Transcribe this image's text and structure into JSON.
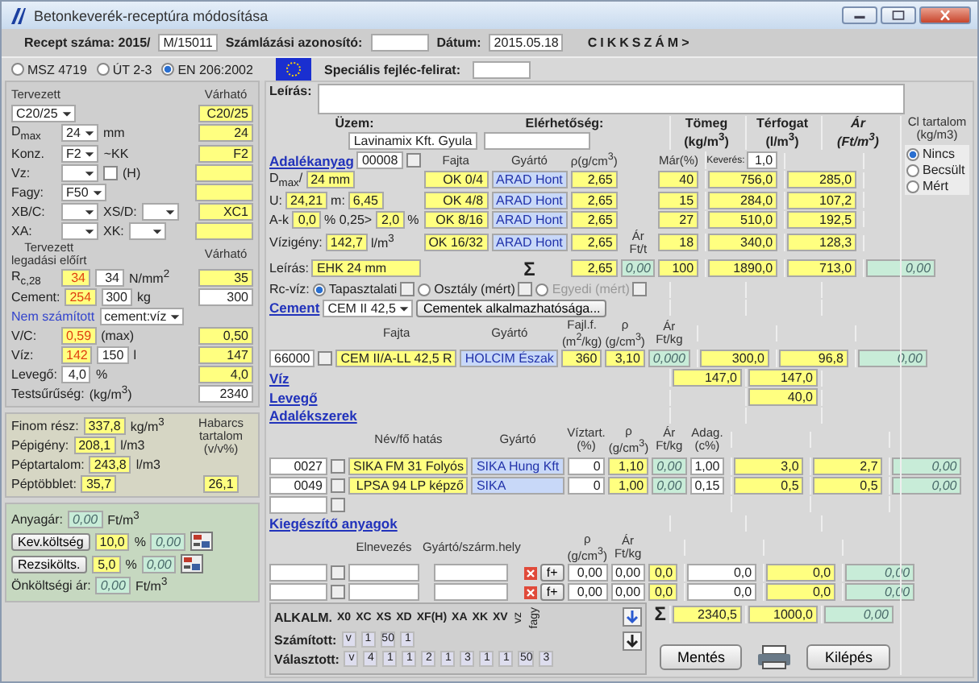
{
  "window": {
    "title": "Betonkeverék-receptúra módosítása"
  },
  "header": [
    {
      "kind": "bold",
      "text": "Recept száma: 2015/"
    },
    {
      "kind": "input",
      "text": "M/15011"
    },
    {
      "kind": "bold",
      "text": "Számlázási azonosító:"
    },
    {
      "kind": "input"
    },
    {
      "kind": "bold",
      "text": "Dátum:"
    },
    {
      "kind": "input",
      "text": "2015.05.18"
    },
    {
      "kind": "code",
      "text": "CIKKSZÁM>"
    }
  ],
  "standards": [
    {
      "kind": "radio",
      "text": "MSZ 4719",
      "selected": false
    },
    {
      "kind": "radio",
      "text": "ÚT 2-3",
      "selected": false
    },
    {
      "kind": "radio",
      "text": "EN 206:2002",
      "selected": true
    }
  ],
  "special": [
    {
      "kind": "flag"
    },
    {
      "kind": "bold",
      "text": "Speciális fejléc-felirat:"
    },
    {
      "kind": "input"
    }
  ],
  "left": {
    "rows": [
      {
        "cells": [
          {
            "kind": "head",
            "text": "Tervezett"
          }
        ],
        "expected": {
          "kind": "head",
          "text": "Várható"
        }
      },
      {
        "cells": [
          {
            "kind": "select",
            "text": "C20/25"
          }
        ],
        "expected": {
          "kind": "value",
          "text": "C20/25"
        }
      },
      {
        "label": "D$_{max}$",
        "cells": [
          {
            "kind": "select",
            "text": "24"
          },
          {
            "kind": "unit",
            "text": "mm"
          }
        ],
        "expected": {
          "kind": "value",
          "text": "24"
        }
      },
      {
        "label": "Konz.",
        "cells": [
          {
            "kind": "select",
            "text": "F2"
          },
          {
            "kind": "unit",
            "text": "~KK"
          }
        ],
        "expected": {
          "kind": "value",
          "text": "F2"
        }
      },
      {
        "label": "Vz:",
        "cells": [
          {
            "kind": "select"
          },
          {
            "kind": "check",
            "checked": false
          },
          {
            "kind": "unit",
            "text": "(H)"
          }
        ],
        "expected": {
          "kind": "value"
        }
      },
      {
        "label": "Fagy:",
        "cells": [
          {
            "kind": "select",
            "text": "F50"
          }
        ],
        "expected": {
          "kind": "value"
        }
      },
      {
        "label": "XB/C:",
        "cells": [
          {
            "kind": "select"
          },
          {
            "kind": "label",
            "text": "XS/D:"
          },
          {
            "kind": "select"
          }
        ],
        "expected": {
          "kind": "value",
          "text": "XC1"
        }
      },
      {
        "label": "XA:",
        "cells": [
          {
            "kind": "select"
          },
          {
            "kind": "label",
            "text": "XK:"
          },
          {
            "kind": "select"
          }
        ],
        "expected": {
          "kind": "value"
        }
      },
      {
        "cells": [
          {
            "kind": "head",
            "text": "Tervezett\nlegadási  előírt"
          }
        ],
        "expected": {
          "kind": "head",
          "text": "Várható"
        }
      },
      {
        "label": "R$_{c,28}$",
        "cells": [
          {
            "kind": "alert",
            "text": "34"
          },
          {
            "kind": "input",
            "text": "34"
          },
          {
            "kind": "unit",
            "text": "N/mm$^{2}$"
          }
        ],
        "expected": {
          "kind": "value",
          "text": "35"
        }
      },
      {
        "label": "Cement:",
        "cells": [
          {
            "kind": "alert",
            "text": "254"
          },
          {
            "kind": "input",
            "text": "300"
          },
          {
            "kind": "unit",
            "text": "kg"
          }
        ],
        "expected": {
          "kind": "input",
          "text": "300"
        }
      },
      {
        "cells": [
          {
            "kind": "note",
            "text": "Nem számított"
          },
          {
            "kind": "select",
            "text": "cement:víz"
          }
        ]
      },
      {
        "label": "V/C:",
        "cells": [
          {
            "kind": "alert",
            "text": "0,59"
          },
          {
            "kind": "unit",
            "text": "(max)"
          }
        ],
        "expected": {
          "kind": "value",
          "text": "0,50"
        }
      },
      {
        "label": "Víz:",
        "cells": [
          {
            "kind": "alert",
            "text": "142"
          },
          {
            "kind": "input",
            "text": "150"
          },
          {
            "kind": "unit",
            "text": "l"
          }
        ],
        "expected": {
          "kind": "value",
          "text": "147"
        }
      },
      {
        "label": "Levegő:",
        "cells": [
          {
            "kind": "input",
            "text": "4,0"
          },
          {
            "kind": "unit",
            "text": "%"
          }
        ],
        "expected": {
          "kind": "value",
          "text": "4,0"
        }
      },
      {
        "label": "Testsűrűség:",
        "cells": [
          {
            "kind": "unit",
            "text": "(kg/m$^{3}$)"
          }
        ],
        "expected": {
          "kind": "input",
          "text": "2340"
        }
      }
    ],
    "stats": {
      "rows": [
        {
          "label": "Finom rész:",
          "cells": [
            {
              "kind": "value",
              "text": "337,8"
            },
            {
              "kind": "unit",
              "text": "kg/m$^{3}$"
            }
          ]
        },
        {
          "label": "Pépigény:",
          "cells": [
            {
              "kind": "value",
              "text": "208,1"
            },
            {
              "kind": "unit",
              "text": "l/m3"
            }
          ]
        },
        {
          "label": "Péptartalom:",
          "cells": [
            {
              "kind": "value",
              "text": "243,8"
            },
            {
              "kind": "unit",
              "text": "l/m3"
            }
          ]
        },
        {
          "label": "Péptöbblet:",
          "cells": [
            {
              "kind": "value",
              "text": "35,7"
            }
          ]
        }
      ],
      "side_title": "Habarcs\ntartalom\n(v/v%)",
      "side_value": "26,1"
    },
    "costs": [
      {
        "cells": [
          {
            "kind": "label",
            "text": "Anyagár:"
          },
          {
            "kind": "money",
            "text": "0,00"
          },
          {
            "kind": "unit",
            "text": "Ft/m$^{3}$"
          }
        ]
      },
      {
        "cells": [
          {
            "kind": "button",
            "text": "Kev.költség"
          },
          {
            "kind": "value",
            "text": "10,0"
          },
          {
            "kind": "unit",
            "text": "%"
          },
          {
            "kind": "money",
            "text": "0,00"
          },
          {
            "kind": "calc"
          }
        ]
      },
      {
        "cells": [
          {
            "kind": "button",
            "text": "Rezsikölts."
          },
          {
            "kind": "value",
            "text": "5,0"
          },
          {
            "kind": "unit",
            "text": "%"
          },
          {
            "kind": "money",
            "text": "0,00"
          },
          {
            "kind": "calc"
          }
        ]
      },
      {
        "cells": [
          {
            "kind": "label",
            "text": "Önköltségi ár:"
          },
          {
            "kind": "money",
            "text": "0,00"
          },
          {
            "kind": "unit",
            "text": "Ft/m$^{3}$"
          }
        ]
      }
    ]
  },
  "right": {
    "description_label": "Leírás:",
    "plant": {
      "label": "Üzem:",
      "value": "Lavinamix Kft. Gyula",
      "contact_label": "Elérhetőség:"
    },
    "columns": [
      {
        "kind": "plain",
        "text": "Tömeg\n(kg/m$^{3}$)"
      },
      {
        "kind": "plain",
        "text": "Térfogat\n(l/m$^{3}$)"
      },
      {
        "kind": "price",
        "text": "Ár\n(Ft/m$^{3}$)"
      }
    ],
    "chloride": {
      "title": "Cl tartalom\n(kg/m3)",
      "options": [
        {
          "kind": "radio",
          "text": "Nincs",
          "selected": true
        },
        {
          "kind": "radio",
          "text": "Becsült",
          "selected": false
        },
        {
          "kind": "radio",
          "text": "Mért",
          "selected": false
        }
      ]
    },
    "sections": [
      {
        "kind": "table",
        "rows": [
          {
            "lead": [
              {
                "kind": "link",
                "text": "Adalékanyag"
              },
              {
                "kind": "input",
                "text": "00008"
              },
              {
                "kind": "browse"
              }
            ],
            "cells": [
              {
                "kind": "head",
                "text": "Fajta"
              },
              {
                "kind": "head",
                "text": "Gyártó"
              },
              {
                "kind": "head",
                "text": "ρ(g/cm$^{3}$)"
              },
              {
                "kind": "empty"
              },
              {
                "kind": "head",
                "text": "Már(%)"
              }
            ],
            "mass": {
              "kind": "input",
              "text": "1,0",
              "label": "Keverés:"
            }
          },
          {
            "lead": [
              {
                "kind": "unit",
                "text": "D$_{max}$/"
              },
              {
                "kind": "value",
                "text": "24 mm"
              }
            ],
            "cells": [
              {
                "kind": "value",
                "text": "OK 0/4"
              },
              {
                "kind": "maker",
                "text": "ARAD Hont"
              },
              {
                "kind": "value",
                "text": "2,65"
              },
              {
                "kind": "empty"
              },
              {
                "kind": "value",
                "text": "40"
              }
            ],
            "mass": {
              "kind": "value",
              "text": "756,0"
            },
            "volume": {
              "kind": "value",
              "text": "285,0"
            }
          },
          {
            "lead": [
              {
                "kind": "unit",
                "text": "U:"
              },
              {
                "kind": "value",
                "text": "24,21"
              },
              {
                "kind": "unit",
                "text": "m:"
              },
              {
                "kind": "value",
                "text": "6,45"
              }
            ],
            "cells": [
              {
                "kind": "value",
                "text": "OK 4/8"
              },
              {
                "kind": "maker",
                "text": "ARAD Hont"
              },
              {
                "kind": "value",
                "text": "2,65"
              },
              {
                "kind": "empty"
              },
              {
                "kind": "value",
                "text": "15"
              }
            ],
            "mass": {
              "kind": "value",
              "text": "284,0"
            },
            "volume": {
              "kind": "value",
              "text": "107,2"
            }
          },
          {
            "lead": [
              {
                "kind": "unit",
                "text": "A-k"
              },
              {
                "kind": "value",
                "text": "0,0"
              },
              {
                "kind": "unit",
                "text": "% 0,25>"
              },
              {
                "kind": "value",
                "text": "2,0"
              },
              {
                "kind": "unit",
                "text": "%"
              }
            ],
            "cells": [
              {
                "kind": "value",
                "text": "OK 8/16"
              },
              {
                "kind": "maker",
                "text": "ARAD Hont"
              },
              {
                "kind": "value",
                "text": "2,65"
              },
              {
                "kind": "empty"
              },
              {
                "kind": "value",
                "text": "27"
              }
            ],
            "mass": {
              "kind": "value",
              "text": "510,0"
            },
            "volume": {
              "kind": "value",
              "text": "192,5"
            }
          },
          {
            "lead": [
              {
                "kind": "unit",
                "text": "Vízigény:"
              },
              {
                "kind": "value",
                "text": "142,7"
              },
              {
                "kind": "unit",
                "text": "l/m$^{3}$"
              }
            ],
            "cells": [
              {
                "kind": "value",
                "text": "OK 16/32"
              },
              {
                "kind": "maker",
                "text": "ARAD Hont"
              },
              {
                "kind": "value",
                "text": "2,65"
              },
              {
                "kind": "head",
                "text": "Ár\nFt/t"
              },
              {
                "kind": "value",
                "text": "18"
              }
            ],
            "mass": {
              "kind": "value",
              "text": "340,0"
            },
            "volume": {
              "kind": "value",
              "text": "128,3"
            }
          },
          {
            "lead": [
              {
                "kind": "unit",
                "text": "Leírás:"
              },
              {
                "kind": "wide-value",
                "text": "EHK 24 mm"
              }
            ],
            "cells": [
              {
                "kind": "empty"
              },
              {
                "kind": "sigma",
                "text": "Σ"
              },
              {
                "kind": "value",
                "text": "2,65"
              },
              {
                "kind": "money",
                "text": "0,00"
              },
              {
                "kind": "value",
                "text": "100"
              }
            ],
            "mass": {
              "kind": "value",
              "text": "1890,0"
            },
            "volume": {
              "kind": "value",
              "text": "713,0"
            },
            "price": {
              "kind": "money",
              "text": "0,00"
            }
          }
        ]
      },
      {
        "kind": "bar",
        "rows": [
          {
            "cells": [
              {
                "kind": "unit",
                "text": "Rc-víz:"
              },
              {
                "kind": "radio",
                "text": "Tapasztalati",
                "selected": true
              },
              {
                "kind": "browse"
              },
              {
                "kind": "radio",
                "text": "Osztály (mért)",
                "selected": false
              },
              {
                "kind": "browse"
              },
              {
                "kind": "radio",
                "text": "Egyedi (mért)",
                "selected": false,
                "disabled": true
              },
              {
                "kind": "browse"
              }
            ]
          },
          {
            "cells": [
              {
                "kind": "link",
                "text": "Cement"
              },
              {
                "kind": "select",
                "text": "CEM II 42,5"
              },
              {
                "kind": "button",
                "text": "Cementek alkalmazhatósága..."
              }
            ]
          }
        ]
      },
      {
        "kind": "table",
        "rows": [
          {
            "cells": [
              {
                "kind": "empty"
              },
              {
                "kind": "empty"
              },
              {
                "kind": "head",
                "text": "Fajta"
              },
              {
                "kind": "head",
                "text": "Gyártó"
              },
              {
                "kind": "head",
                "text": "Fajl.f.\n(m$^{2}$/kg)"
              },
              {
                "kind": "head",
                "text": "ρ\n(g/cm$^{3}$)"
              },
              {
                "kind": "head",
                "text": "Ár\nFt/kg"
              }
            ]
          },
          {
            "cells": [
              {
                "kind": "input",
                "text": "66000"
              },
              {
                "kind": "browse"
              },
              {
                "kind": "value",
                "text": "CEM II/A-LL 42,5 R"
              },
              {
                "kind": "maker",
                "text": "HOLCIM Észak"
              },
              {
                "kind": "value",
                "text": "360"
              },
              {
                "kind": "value",
                "text": "3,10"
              },
              {
                "kind": "money",
                "text": "0,000"
              }
            ],
            "mass": {
              "kind": "value",
              "text": "300,0"
            },
            "volume": {
              "kind": "value",
              "text": "96,8"
            },
            "price": {
              "kind": "money",
              "text": "0,00"
            }
          }
        ]
      },
      {
        "kind": "bar",
        "rows": [
          {
            "cells": [
              {
                "kind": "link",
                "text": "Víz"
              }
            ],
            "mass": {
              "kind": "value",
              "text": "147,0"
            },
            "volume": {
              "kind": "value",
              "text": "147,0"
            }
          },
          {
            "cells": [
              {
                "kind": "link",
                "text": "Levegő"
              }
            ],
            "volume": {
              "kind": "value",
              "text": "40,0"
            }
          },
          {
            "cells": [
              {
                "kind": "link",
                "text": "Adalékszerek"
              }
            ]
          }
        ]
      },
      {
        "kind": "table",
        "rows": [
          {
            "cells": [
              {
                "kind": "empty"
              },
              {
                "kind": "empty"
              },
              {
                "kind": "head",
                "text": "Név/fő hatás"
              },
              {
                "kind": "head",
                "text": "Gyártó"
              },
              {
                "kind": "head",
                "text": "Víztart.\n(%)"
              },
              {
                "kind": "head",
                "text": "ρ\n(g/cm$^{3}$)"
              },
              {
                "kind": "head",
                "text": "Ár\nFt/kg"
              },
              {
                "kind": "head",
                "text": "Adag.\n(c%)"
              }
            ]
          },
          {
            "cells": [
              {
                "kind": "input",
                "text": "0027"
              },
              {
                "kind": "browse"
              },
              {
                "kind": "value",
                "text": "SIKA FM 31 Folyós"
              },
              {
                "kind": "maker",
                "text": "SIKA Hung Kft"
              },
              {
                "kind": "input",
                "text": "0"
              },
              {
                "kind": "value",
                "text": "1,10"
              },
              {
                "kind": "money",
                "text": "0,00"
              },
              {
                "kind": "input",
                "text": "1,00"
              }
            ],
            "mass": {
              "kind": "value",
              "text": "3,0"
            },
            "volume": {
              "kind": "value",
              "text": "2,7"
            },
            "price": {
              "kind": "money",
              "text": "0,00"
            }
          },
          {
            "cells": [
              {
                "kind": "input",
                "text": "0049"
              },
              {
                "kind": "browse"
              },
              {
                "kind": "value",
                "text": "LPSA 94 LP képző"
              },
              {
                "kind": "maker",
                "text": "SIKA"
              },
              {
                "kind": "input",
                "text": "0"
              },
              {
                "kind": "value",
                "text": "1,00"
              },
              {
                "kind": "money",
                "text": "0,00"
              },
              {
                "kind": "input",
                "text": "0,15"
              }
            ],
            "mass": {
              "kind": "value",
              "text": "0,5"
            },
            "volume": {
              "kind": "value",
              "text": "0,5"
            },
            "price": {
              "kind": "money",
              "text": "0,00"
            }
          },
          {
            "cells": [
              {
                "kind": "input"
              },
              {
                "kind": "browse"
              }
            ]
          }
        ]
      },
      {
        "kind": "bar",
        "rows": [
          {
            "cells": [
              {
                "kind": "link",
                "text": "Kiegészítő anyagok"
              }
            ]
          }
        ]
      },
      {
        "kind": "table",
        "rows": [
          {
            "cells": [
              {
                "kind": "empty"
              },
              {
                "kind": "empty"
              },
              {
                "kind": "head",
                "text": "Elnevezés"
              },
              {
                "kind": "head",
                "text": "Gyártó/szárm.hely"
              },
              {
                "kind": "empty"
              },
              {
                "kind": "empty"
              },
              {
                "kind": "head",
                "text": "ρ\n(g/cm$^{3}$)"
              },
              {
                "kind": "head",
                "text": "Ár\nFt/kg"
              }
            ]
          },
          {
            "cells": [
              {
                "kind": "input"
              },
              {
                "kind": "browse"
              },
              {
                "kind": "wide-input"
              },
              {
                "kind": "wide-input"
              },
              {
                "kind": "remove"
              },
              {
                "kind": "button",
                "text": "f+"
              },
              {
                "kind": "input",
                "text": "0,00"
              },
              {
                "kind": "input",
                "text": "0,00"
              },
              {
                "kind": "value",
                "text": "0,0"
              }
            ],
            "mass": {
              "kind": "input",
              "text": "0,0"
            },
            "volume": {
              "kind": "value",
              "text": "0,0"
            },
            "price": {
              "kind": "money",
              "text": "0,00"
            }
          },
          {
            "cells": [
              {
                "kind": "input"
              },
              {
                "kind": "browse"
              },
              {
                "kind": "wide-input"
              },
              {
                "kind": "wide-input"
              },
              {
                "kind": "remove"
              },
              {
                "kind": "button",
                "text": "f+"
              },
              {
                "kind": "input",
                "text": "0,00"
              },
              {
                "kind": "input",
                "text": "0,00"
              },
              {
                "kind": "value",
                "text": "0,0"
              }
            ],
            "mass": {
              "kind": "input",
              "text": "0,0"
            },
            "volume": {
              "kind": "value",
              "text": "0,0"
            },
            "price": {
              "kind": "money",
              "text": "0,00"
            }
          }
        ]
      }
    ]
  },
  "exposure": {
    "title": "ALKALM.",
    "classes": [
      "X0",
      "XC",
      "XS",
      "XD",
      "XF(H)",
      "XA",
      "XK",
      "XV"
    ],
    "rotated": [
      "vz",
      "fagy"
    ],
    "computed_label": "Számított:",
    "computed": [
      "v",
      "1",
      "50",
      "1"
    ],
    "chosen_label": "Választott:",
    "chosen": [
      "v",
      "4",
      "1",
      "1",
      "2",
      "1",
      "3",
      "1",
      "1",
      "50",
      "3"
    ]
  },
  "totals": {
    "sigma": "Σ",
    "mass": "2340,5",
    "volume": "1000,0",
    "price": "0,00"
  },
  "buttons": [
    {
      "kind": "text",
      "text": "Mentés"
    },
    {
      "kind": "print"
    },
    {
      "kind": "text",
      "text": "Kilépés"
    }
  ]
}
